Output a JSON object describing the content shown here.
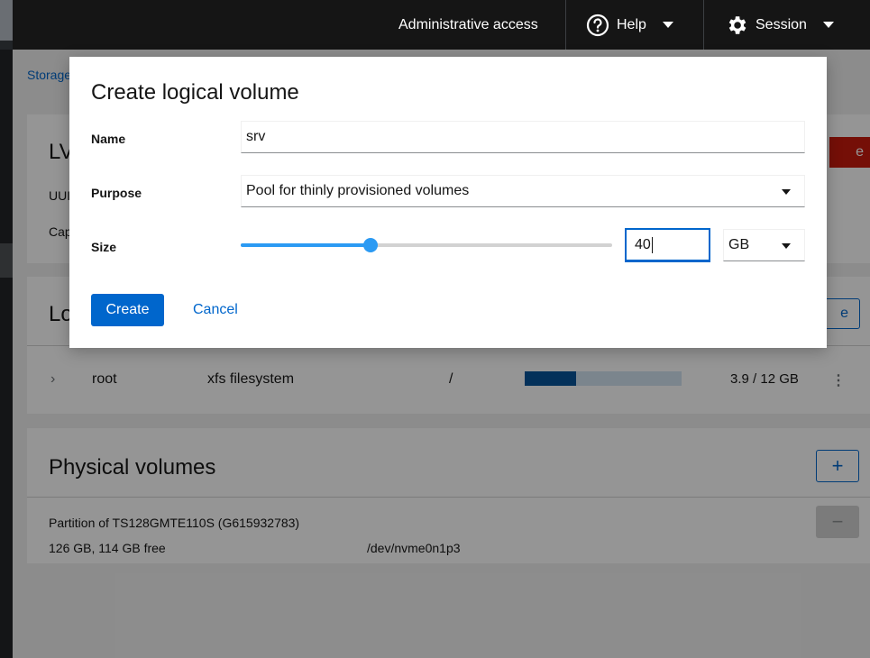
{
  "topbar": {
    "admin_label": "Administrative access",
    "help_label": "Help",
    "session_label": "Session"
  },
  "page": {
    "breadcrumb": "Storage",
    "vg_card": {
      "title": "LV",
      "uuid_label": "UUI",
      "capacity_label": "Cap",
      "delete_label": "e"
    },
    "lv_card": {
      "title": "Lo",
      "create_label": "e",
      "rows": [
        {
          "name": "root",
          "type": "xfs filesystem",
          "mount": "/",
          "usage": "3.9 / 12 GB",
          "usage_fraction": 0.325
        }
      ]
    },
    "pv_card": {
      "title": "Physical volumes",
      "add_label": "+",
      "remove_label": "−",
      "items": [
        {
          "name": "Partition of TS128GMTE110S (G615932783)",
          "size": "126 GB, 114 GB free",
          "device": "/dev/nvme0n1p3"
        }
      ]
    }
  },
  "dialog": {
    "title": "Create logical volume",
    "fields": {
      "name_label": "Name",
      "name_value": "srv",
      "purpose_label": "Purpose",
      "purpose_value": "Pool for thinly provisioned volumes",
      "size_label": "Size",
      "size_value": "40",
      "size_fraction": 0.35,
      "unit_value": "GB"
    },
    "create_label": "Create",
    "cancel_label": "Cancel"
  },
  "colors": {
    "accent": "#0066cc",
    "slider": "#2b9af3",
    "danger": "#c9190b",
    "topbar": "#151515"
  }
}
